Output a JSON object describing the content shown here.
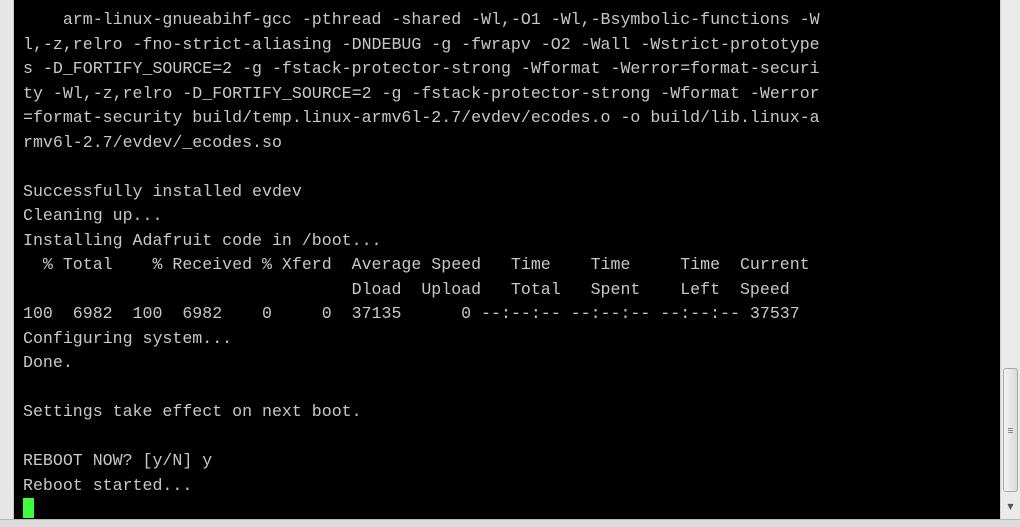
{
  "terminal": {
    "lines": [
      "    arm-linux-gnueabihf-gcc -pthread -shared -Wl,-O1 -Wl,-Bsymbolic-functions -W",
      "l,-z,relro -fno-strict-aliasing -DNDEBUG -g -fwrapv -O2 -Wall -Wstrict-prototype",
      "s -D_FORTIFY_SOURCE=2 -g -fstack-protector-strong -Wformat -Werror=format-securi",
      "ty -Wl,-z,relro -D_FORTIFY_SOURCE=2 -g -fstack-protector-strong -Wformat -Werror",
      "=format-security build/temp.linux-armv6l-2.7/evdev/ecodes.o -o build/lib.linux-a",
      "rmv6l-2.7/evdev/_ecodes.so",
      "",
      "Successfully installed evdev",
      "Cleaning up...",
      "Installing Adafruit code in /boot...",
      "  % Total    % Received % Xferd  Average Speed   Time    Time     Time  Current",
      "                                 Dload  Upload   Total   Spent    Left  Speed",
      "100  6982  100  6982    0     0  37135      0 --:--:-- --:--:-- --:--:-- 37537",
      "Configuring system...",
      "Done.",
      "",
      "Settings take effect on next boot.",
      "",
      "REBOOT NOW? [y/N] y",
      "Reboot started..."
    ]
  },
  "colors": {
    "background": "#000000",
    "text": "#c8c8c8",
    "cursor": "#3cff3c"
  },
  "icons": {
    "scroll_down": "triangle-down-icon"
  }
}
